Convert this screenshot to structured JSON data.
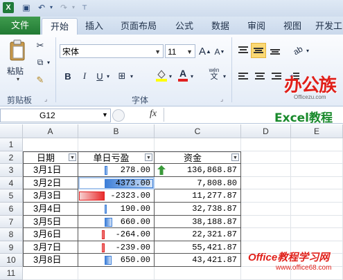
{
  "app": {
    "logo_text": "X"
  },
  "quick_access": {
    "save_icon": "save-icon",
    "undo_icon": "undo-icon",
    "redo_icon": "redo-icon"
  },
  "tabs": [
    {
      "label": "文件"
    },
    {
      "label": "开始"
    },
    {
      "label": "插入"
    },
    {
      "label": "页面布局"
    },
    {
      "label": "公式"
    },
    {
      "label": "数据"
    },
    {
      "label": "审阅"
    },
    {
      "label": "视图"
    },
    {
      "label": "开发工"
    }
  ],
  "ribbon": {
    "clipboard": {
      "paste_label": "粘贴",
      "group_label": "剪贴板"
    },
    "font": {
      "font_name": "宋体",
      "font_size": "11",
      "grow_label": "A",
      "shrink_label": "A",
      "bold": "B",
      "italic": "I",
      "underline": "U",
      "font_color_label": "A",
      "phonetic_label": "wén",
      "group_label": "字体"
    }
  },
  "watermark": {
    "top_brand": "办公族",
    "top_brand_sub": "Officezu.com",
    "excel_title": "Excel教程",
    "bottom_brand": "Office教程学习网",
    "bottom_url": "www.office68.com"
  },
  "formula_bar": {
    "cell_ref": "G12",
    "fx_label": "fx",
    "formula": ""
  },
  "sheet": {
    "columns": [
      "A",
      "B",
      "C",
      "D",
      "E"
    ],
    "rows": [
      "1",
      "2",
      "3",
      "4",
      "5",
      "6",
      "7",
      "8",
      "9",
      "10",
      "11"
    ],
    "headers": {
      "date": "日期",
      "daily_pnl": "单日亏盈",
      "funds": "资金"
    },
    "data": [
      {
        "date": "3月1日",
        "pnl": "278.00",
        "pnl_value": 278,
        "funds": "136,868.87"
      },
      {
        "date": "3月2日",
        "pnl": "4373.00",
        "pnl_value": 4373,
        "funds": "7,808.80"
      },
      {
        "date": "3月3日",
        "pnl": "-2323.00",
        "pnl_value": -2323,
        "funds": "11,277.87"
      },
      {
        "date": "3月4日",
        "pnl": "190.00",
        "pnl_value": 190,
        "funds": "32,738.87"
      },
      {
        "date": "3月5日",
        "pnl": "660.00",
        "pnl_value": 660,
        "funds": "38,188.87"
      },
      {
        "date": "3月6日",
        "pnl": "-264.00",
        "pnl_value": -264,
        "funds": "22,321.87"
      },
      {
        "date": "3月7日",
        "pnl": "-239.00",
        "pnl_value": -239,
        "funds": "55,421.87"
      },
      {
        "date": "3月8日",
        "pnl": "650.00",
        "pnl_value": 650,
        "funds": "43,421.87"
      }
    ],
    "pnl_scale_max": 4373,
    "colors": {
      "pos_bar": "#3c7ed8",
      "neg_bar": "#e02020",
      "arrow_up": "#3a9a3a"
    }
  }
}
